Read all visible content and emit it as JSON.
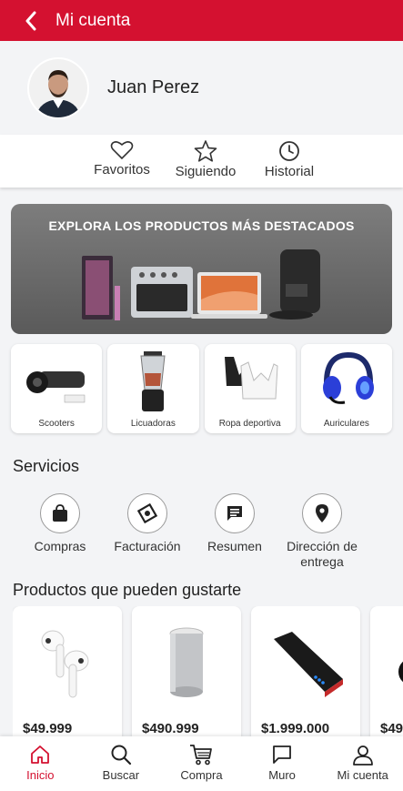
{
  "header": {
    "title": "Mi cuenta"
  },
  "profile": {
    "name": "Juan Perez"
  },
  "quick_actions": [
    {
      "label": "Favoritos",
      "icon": "heart-icon"
    },
    {
      "label": "Siguiendo",
      "icon": "star-icon"
    },
    {
      "label": "Historial",
      "icon": "clock-icon"
    }
  ],
  "banner": {
    "title": "EXPLORA LOS PRODUCTOS MÁS DESTACADOS"
  },
  "categories": [
    {
      "label": "Scooters",
      "icon": "hoverboard-icon"
    },
    {
      "label": "Licuadoras",
      "icon": "blender-icon"
    },
    {
      "label": "Ropa deportiva",
      "icon": "sports-bra-icon"
    },
    {
      "label": "Auriculares",
      "icon": "headset-icon"
    }
  ],
  "services": {
    "title": "Servicios",
    "items": [
      {
        "label": "Compras",
        "icon": "shopping-bag-icon"
      },
      {
        "label": "Facturación",
        "icon": "invoice-icon"
      },
      {
        "label": "Resumen",
        "icon": "message-icon"
      },
      {
        "label": "Dirección de entrega",
        "icon": "location-pin-icon"
      }
    ]
  },
  "recommended": {
    "title": "Productos que pueden gustarte",
    "items": [
      {
        "price": "$49.999",
        "icon": "earbuds-icon"
      },
      {
        "price": "$490.999",
        "icon": "speaker-icon"
      },
      {
        "price": "$1.999.000",
        "icon": "power-bank-icon"
      },
      {
        "price": "$49",
        "icon": "product-icon"
      }
    ]
  },
  "tabbar": [
    {
      "label": "Inicio",
      "icon": "home-icon",
      "active": true
    },
    {
      "label": "Buscar",
      "icon": "search-icon"
    },
    {
      "label": "Compra",
      "icon": "cart-icon"
    },
    {
      "label": "Muro",
      "icon": "chat-icon"
    },
    {
      "label": "Mi cuenta",
      "icon": "user-icon"
    }
  ],
  "colors": {
    "brand": "#d41130",
    "background": "#f3f4f6"
  }
}
